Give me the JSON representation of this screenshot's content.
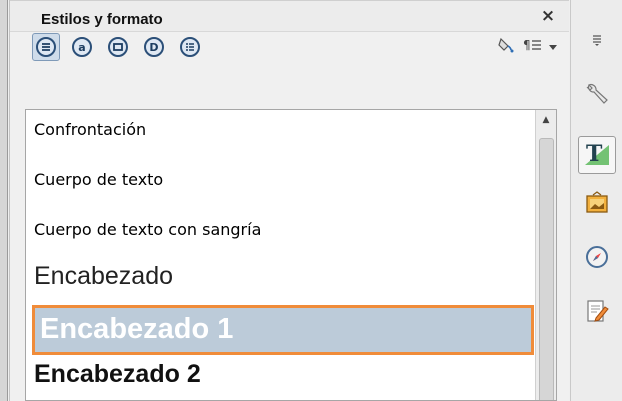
{
  "panel": {
    "title": "Estilos y formato",
    "close_label": "×"
  },
  "toolbar": {
    "buttons": [
      {
        "name": "paragraph-styles",
        "glyph": "≡",
        "active": true
      },
      {
        "name": "character-styles",
        "glyph": "a",
        "active": false
      },
      {
        "name": "frame-styles",
        "glyph": "▢",
        "active": false
      },
      {
        "name": "page-styles",
        "glyph": "D",
        "active": false
      },
      {
        "name": "list-styles",
        "glyph": "⋮≡",
        "active": false
      }
    ],
    "fill_format_icon": "fill-format-icon",
    "new_style_icon": "new-style-icon",
    "dropdown_icon": "chevron-down-icon"
  },
  "styles_list": [
    {
      "label": "Confrontación"
    },
    {
      "label": "Cuerpo de texto"
    },
    {
      "label": "Cuerpo de texto con sangría"
    },
    {
      "label": "Encabezado"
    },
    {
      "label": "Encabezado 1",
      "selected": true
    },
    {
      "label": "Encabezado 2"
    }
  ],
  "sidebar": {
    "items": [
      {
        "icon": "menu-icon"
      },
      {
        "icon": "properties-wrench-icon"
      },
      {
        "icon": "styles-icon",
        "active": true
      },
      {
        "icon": "gallery-icon"
      },
      {
        "icon": "navigator-icon"
      },
      {
        "icon": "manage-changes-icon"
      }
    ]
  },
  "colors": {
    "selection_bg": "#bccbd9",
    "selection_border": "#f08c3a",
    "active_button": "#cfdcea"
  }
}
